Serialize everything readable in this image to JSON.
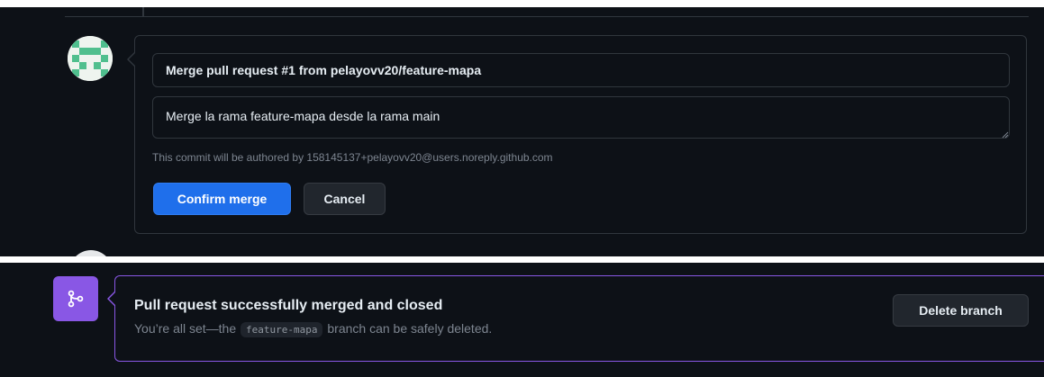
{
  "merge_form": {
    "commit_title": "Merge pull request #1 from pelayovv20/feature-mapa",
    "commit_body": "Merge la rama feature-mapa desde la rama main",
    "author_note": "This commit will be authored by 158145137+pelayovv20@users.noreply.github.com",
    "confirm_label": "Confirm merge",
    "cancel_label": "Cancel"
  },
  "merged_notice": {
    "title": "Pull request successfully merged and closed",
    "desc_prefix": "You’re all set—the",
    "branch_name": "feature-mapa",
    "desc_suffix": "branch can be safely deleted.",
    "delete_label": "Delete branch"
  },
  "icons": {
    "user_avatar": "identicon-avatar",
    "merged_status": "git-merge-icon",
    "textarea_resize": "resize-handle-icon"
  },
  "colors": {
    "background": "#0d1117",
    "border": "#30363d",
    "primary_button": "#1f6feb",
    "merged_accent": "#8957e5",
    "identicon": "#4fbf8e",
    "muted_text": "#7d8590"
  }
}
